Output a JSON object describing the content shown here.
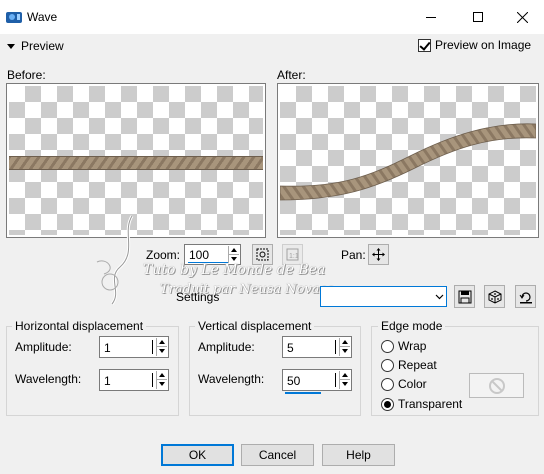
{
  "window": {
    "title": "Wave"
  },
  "preview": {
    "toggle_label": "Preview",
    "preview_on_image_label": "Preview on Image",
    "preview_on_image_checked": true,
    "before_label": "Before:",
    "after_label": "After:"
  },
  "zoom": {
    "label": "Zoom:",
    "value": "100"
  },
  "pan": {
    "label": "Pan:"
  },
  "watermark": {
    "line1": "Tuto by Le Monde de Bea",
    "line2": "Traduit par Neusa Novaes"
  },
  "settings": {
    "label": "Settings",
    "value": ""
  },
  "horizontal": {
    "title": "Horizontal displacement",
    "amplitude_label": "Amplitude:",
    "amplitude_value": "1",
    "wavelength_label": "Wavelength:",
    "wavelength_value": "1"
  },
  "vertical": {
    "title": "Vertical displacement",
    "amplitude_label": "Amplitude:",
    "amplitude_value": "5",
    "wavelength_label": "Wavelength:",
    "wavelength_value": "50"
  },
  "edge_mode": {
    "title": "Edge mode",
    "options": [
      "Wrap",
      "Repeat",
      "Color",
      "Transparent"
    ],
    "selected": "Transparent"
  },
  "buttons": {
    "ok": "OK",
    "cancel": "Cancel",
    "help": "Help"
  },
  "colors": {
    "accent": "#0078d7",
    "rope": "#a8957c",
    "checker": "#cccccc"
  }
}
